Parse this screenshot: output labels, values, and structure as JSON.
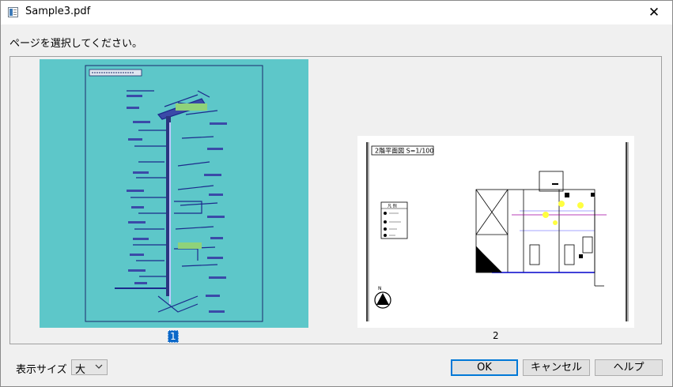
{
  "window": {
    "title": "Sample3.pdf",
    "close_glyph": "✕"
  },
  "prompt": "ページを選択してください。",
  "pages": [
    {
      "label": "1",
      "selected": true
    },
    {
      "label": "2",
      "selected": false
    }
  ],
  "page2_drawing": {
    "title": "2階平面図 S=1/100",
    "legend_title": "凡 例",
    "north_label": "N"
  },
  "size": {
    "label": "表示サイズ",
    "value": "大"
  },
  "buttons": {
    "ok": "OK",
    "cancel": "キャンセル",
    "help": "ヘルプ"
  },
  "colors": {
    "selection": "#0c68c8",
    "thumb_highlight": "#5dc7c9",
    "default_button_border": "#0078d7"
  },
  "icons": [
    "app-icon",
    "close-icon",
    "chevron-down-icon",
    "north-arrow-icon"
  ]
}
